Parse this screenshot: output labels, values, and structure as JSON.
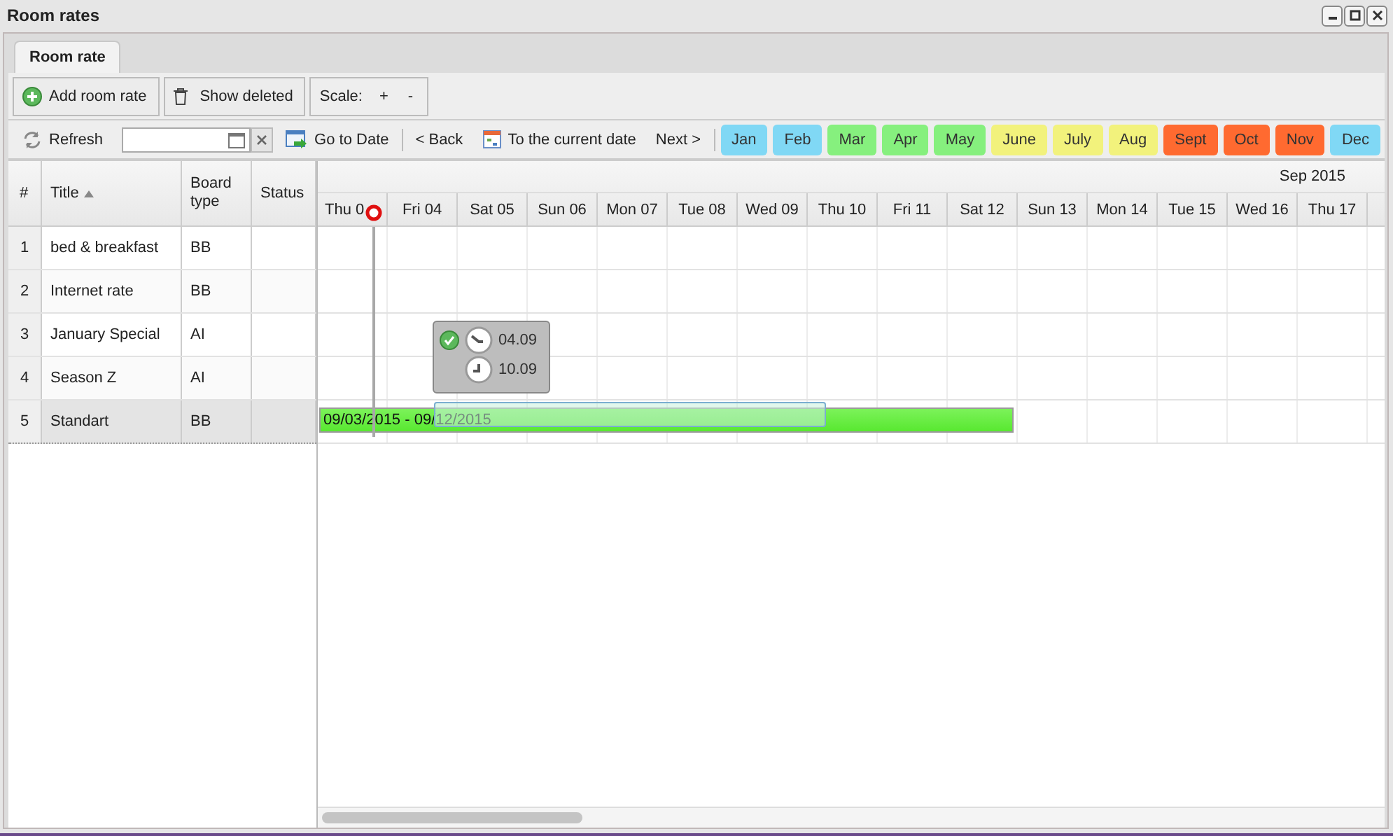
{
  "window": {
    "title": "Room rates"
  },
  "tabs": [
    {
      "label": "Room rate",
      "selected": true
    }
  ],
  "toolbar": {
    "add": "Add room rate",
    "show_deleted": "Show deleted",
    "scale_label": "Scale:",
    "scale_plus": "+",
    "scale_minus": "-"
  },
  "nav": {
    "refresh": "Refresh",
    "go_to_date": "Go to Date",
    "back": "< Back",
    "current": "To the current date",
    "next": "Next >"
  },
  "months": [
    {
      "label": "Jan",
      "color": "#80d8f5"
    },
    {
      "label": "Feb",
      "color": "#80d8f5"
    },
    {
      "label": "Mar",
      "color": "#86f07e"
    },
    {
      "label": "Apr",
      "color": "#86f07e"
    },
    {
      "label": "May",
      "color": "#86f07e"
    },
    {
      "label": "June",
      "color": "#f2f27c"
    },
    {
      "label": "July",
      "color": "#f2f27c"
    },
    {
      "label": "Aug",
      "color": "#f2f27c"
    },
    {
      "label": "Sept",
      "color": "#ff6a30"
    },
    {
      "label": "Oct",
      "color": "#ff6a30"
    },
    {
      "label": "Nov",
      "color": "#ff6a30"
    },
    {
      "label": "Dec",
      "color": "#80d8f5"
    }
  ],
  "columns": [
    "#",
    "Title",
    "Board type",
    "Status"
  ],
  "rows": [
    {
      "num": "1",
      "title": "bed & breakfast",
      "board": "BB",
      "selected": false
    },
    {
      "num": "2",
      "title": "Internet rate",
      "board": "BB",
      "selected": false
    },
    {
      "num": "3",
      "title": "January Special",
      "board": "AI",
      "selected": false
    },
    {
      "num": "4",
      "title": "Season Z",
      "board": "AI",
      "selected": false
    },
    {
      "num": "5",
      "title": "Standart",
      "board": "BB",
      "selected": true
    }
  ],
  "timeline": {
    "month": "Sep 2015",
    "days": [
      "Thu 0",
      "Fri 04",
      "Sat 05",
      "Sun 06",
      "Mon 07",
      "Tue 08",
      "Wed 09",
      "Thu 10",
      "Fri 11",
      "Sat 12",
      "Sun 13",
      "Mon 14",
      "Tue 15",
      "Wed 16",
      "Thu 17"
    ],
    "event": {
      "label": "09/03/2015 - 09/12/2015"
    },
    "tooltip": {
      "start": "04.09",
      "end": "10.09"
    }
  }
}
